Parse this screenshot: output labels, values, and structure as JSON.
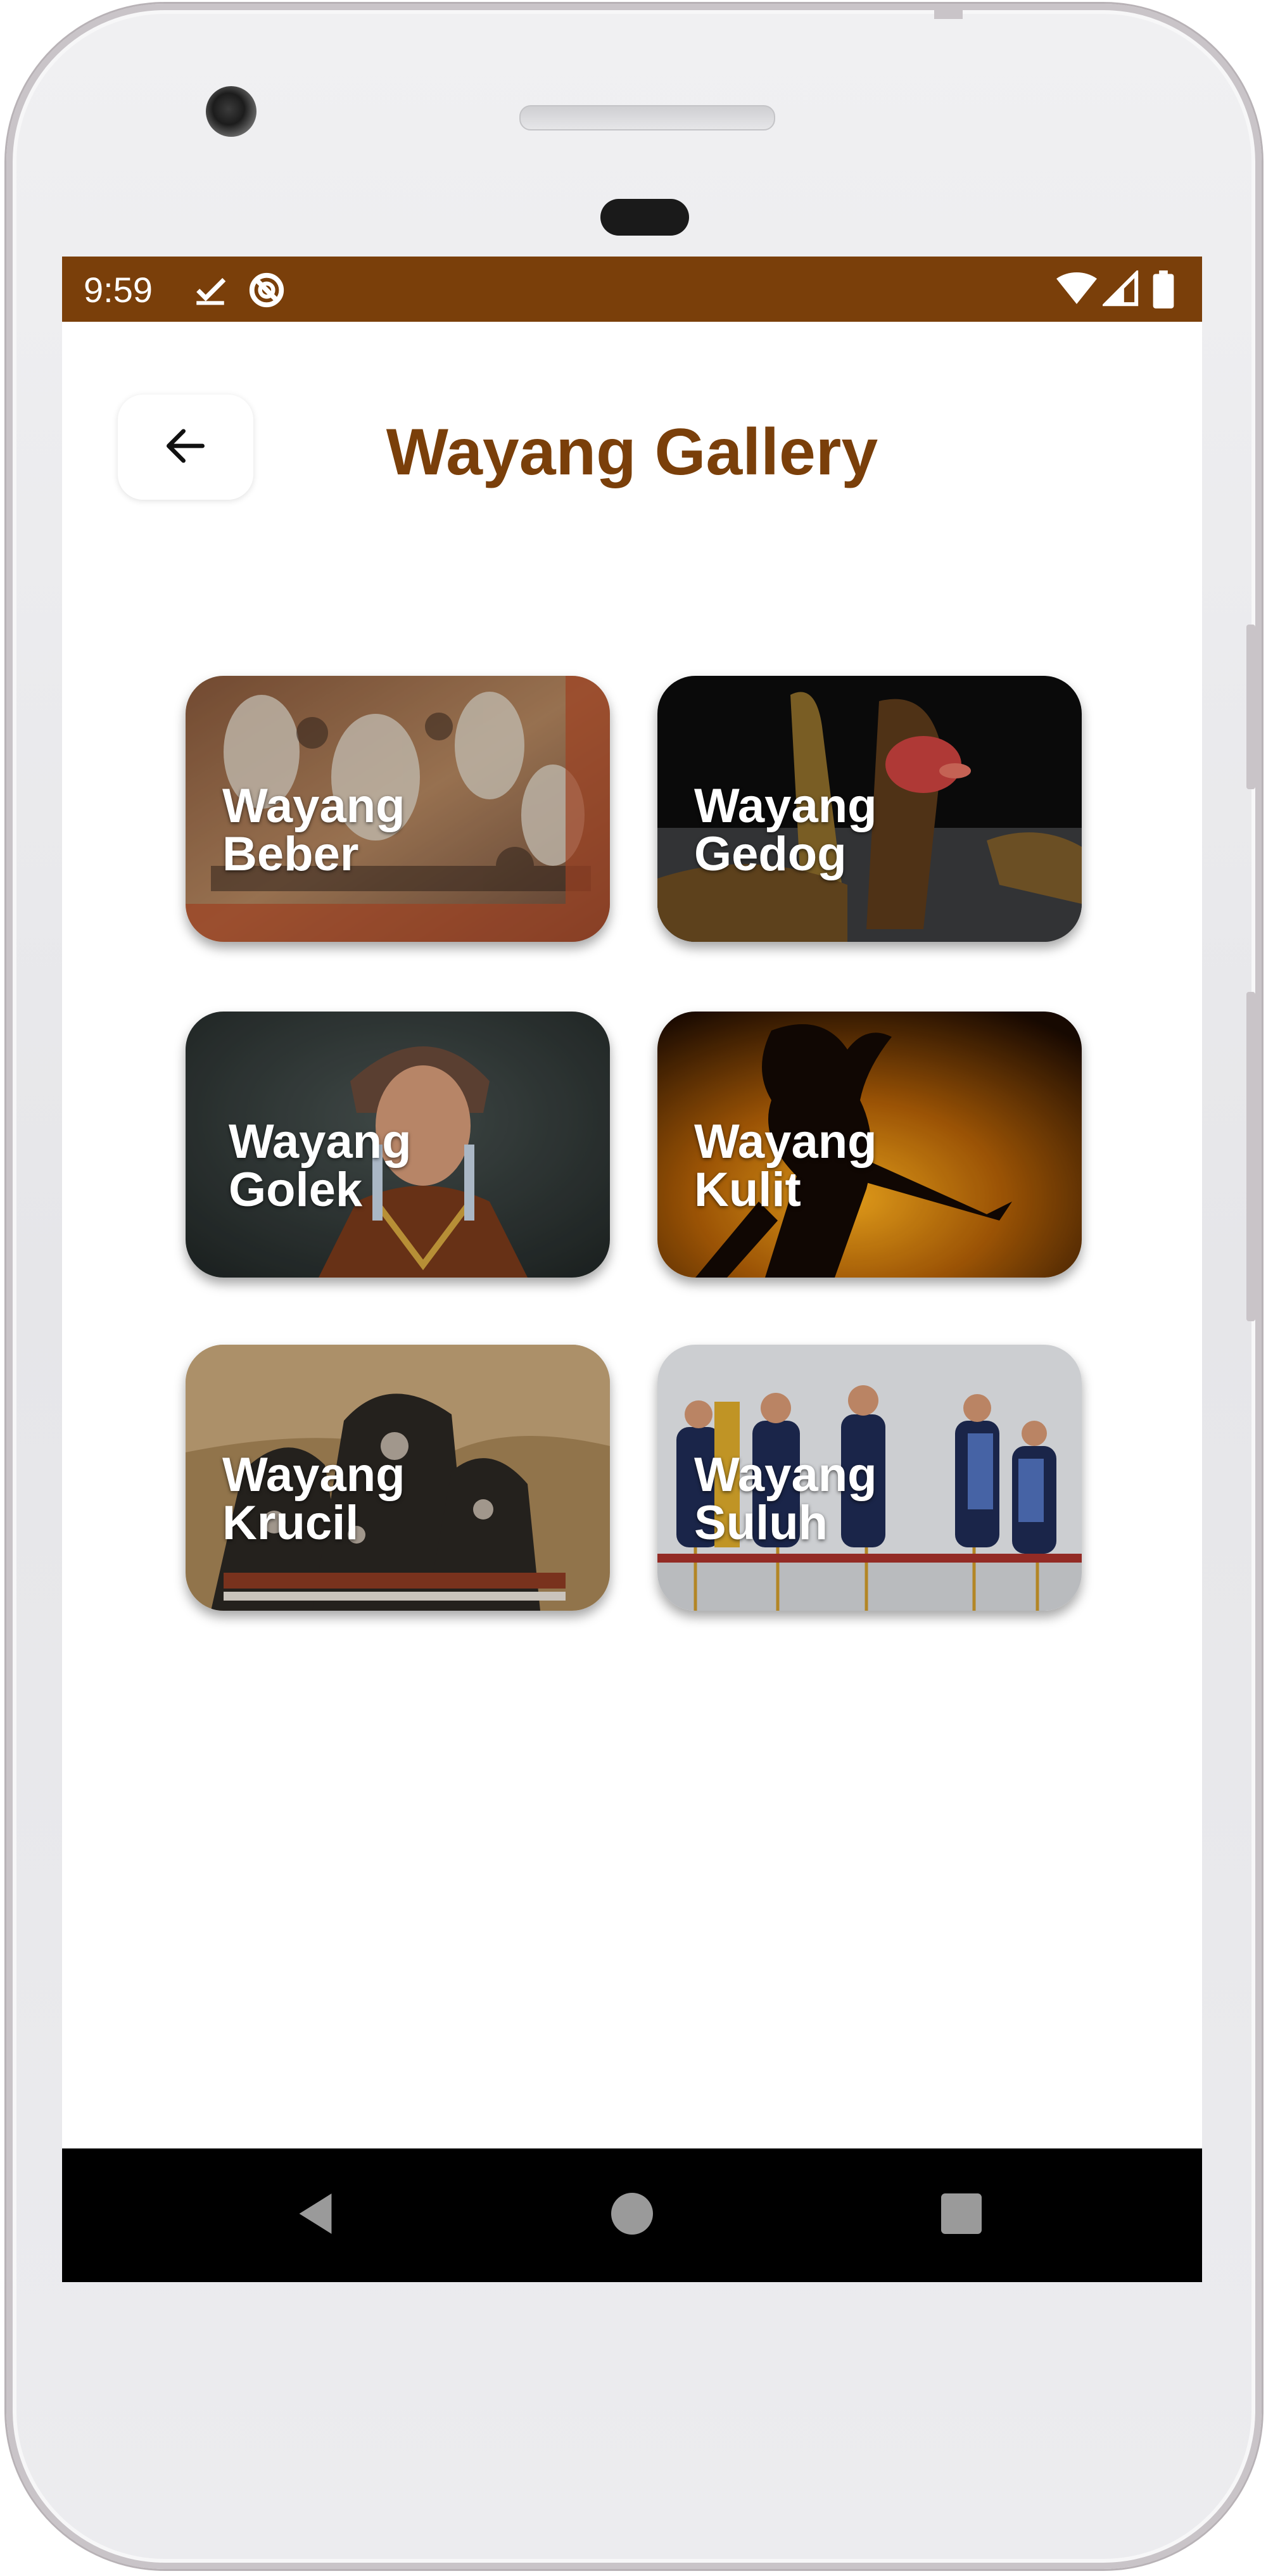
{
  "status_bar": {
    "time": "9:59",
    "icons": [
      "download-done-icon",
      "sync-disabled-icon",
      "wifi-icon",
      "signal-icon",
      "battery-icon"
    ],
    "color": "#7a3f0a"
  },
  "header": {
    "back_icon": "arrow-left-icon",
    "title": "Wayang Gallery",
    "title_color": "#7a3f0a"
  },
  "gallery": {
    "items": [
      {
        "line1": "Wayang",
        "line2": "Beber"
      },
      {
        "line1": "Wayang",
        "line2": "Gedog"
      },
      {
        "line1": "Wayang",
        "line2": "Golek"
      },
      {
        "line1": "Wayang",
        "line2": "Kulit"
      },
      {
        "line1": "Wayang",
        "line2": "Krucil"
      },
      {
        "line1": "Wayang",
        "line2": "Suluh"
      }
    ]
  },
  "nav_bar": {
    "icons": [
      "back-triangle-icon",
      "home-circle-icon",
      "recents-square-icon"
    ]
  }
}
